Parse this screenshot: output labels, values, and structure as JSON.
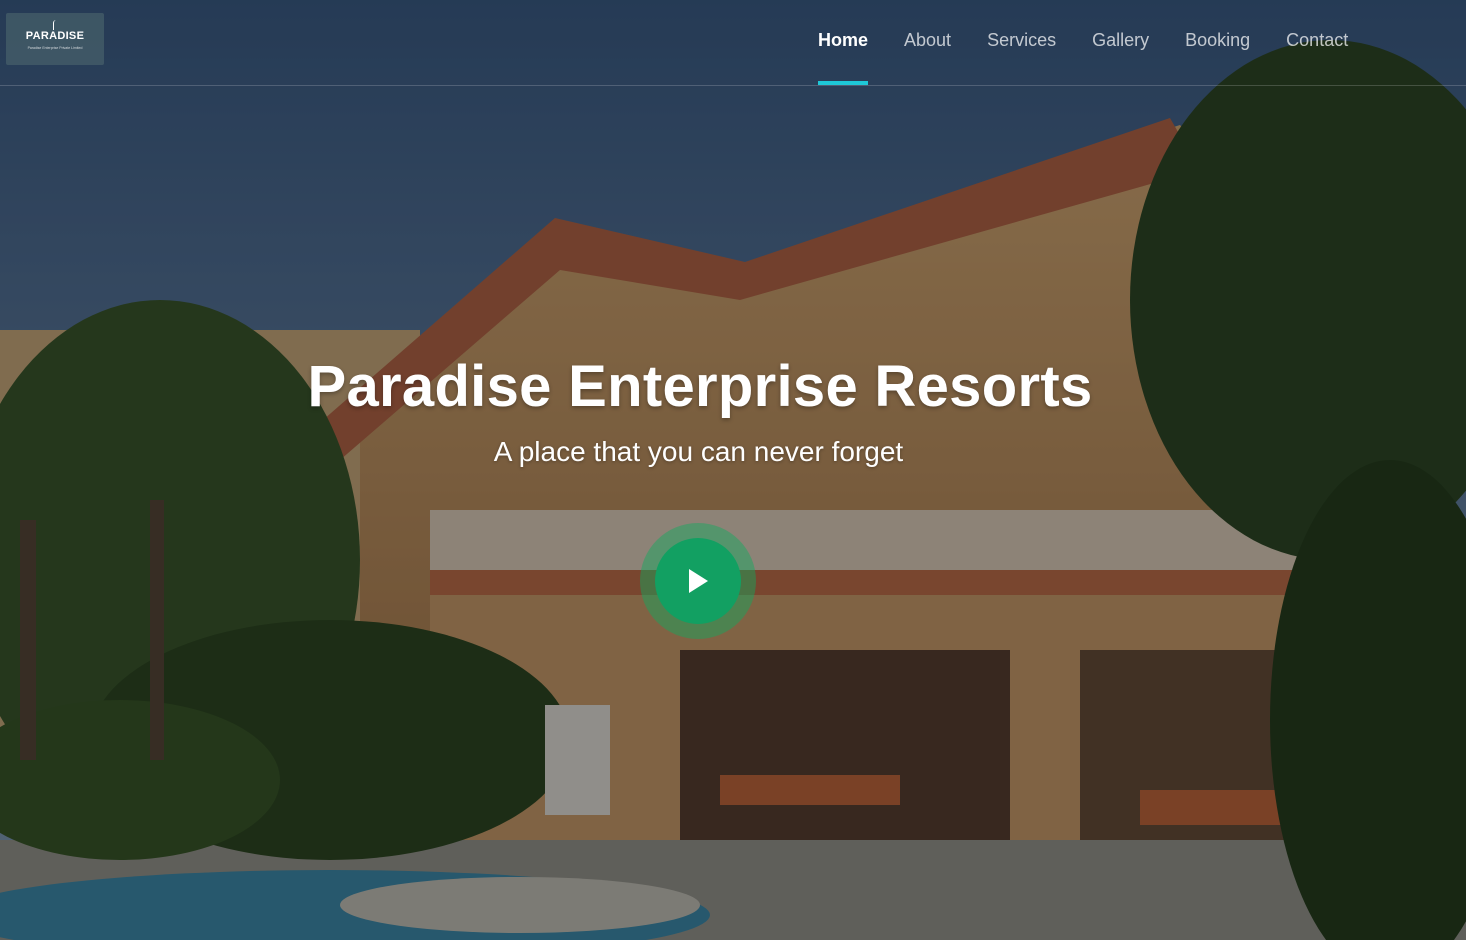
{
  "logo": {
    "name": "PARADISE",
    "tagline": "Paradise Enterprise Private Limited"
  },
  "nav": {
    "items": [
      {
        "label": "Home",
        "active": true
      },
      {
        "label": "About",
        "active": false
      },
      {
        "label": "Services",
        "active": false
      },
      {
        "label": "Gallery",
        "active": false
      },
      {
        "label": "Booking",
        "active": false
      },
      {
        "label": "Contact",
        "active": false
      }
    ]
  },
  "hero": {
    "title": "Paradise Enterprise Resorts",
    "subtitle": "A place that you can never forget",
    "play_icon": "play-icon"
  },
  "colors": {
    "accent": "#1ec8d8",
    "play_button": "#12a062"
  }
}
